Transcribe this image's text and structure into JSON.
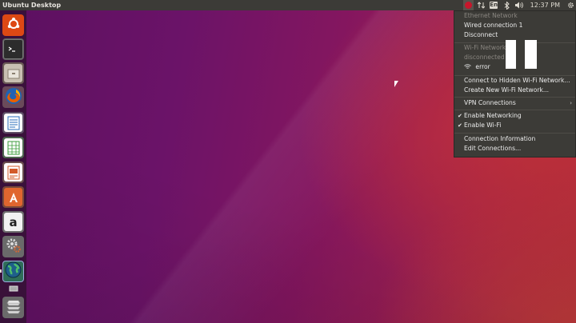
{
  "topbar": {
    "title": "Ubuntu Desktop",
    "clock": "12:37 PM",
    "keyboard_indicator": "En",
    "icons": [
      "network-icon",
      "transfer-arrows-icon",
      "keyboard-layout-icon",
      "bluetooth-icon",
      "volume-icon",
      "gear-icon"
    ]
  },
  "launcher": {
    "items": [
      {
        "name": "ubuntu-dash",
        "icon": "ubuntu-logo-icon",
        "color": "#dd4814"
      },
      {
        "name": "terminal",
        "icon": "terminal-icon",
        "color": "#2c2c2c"
      },
      {
        "name": "file-manager",
        "icon": "file-cabinet-icon",
        "color": "#b4a99a"
      },
      {
        "name": "firefox",
        "icon": "firefox-icon",
        "color": "#e66000"
      },
      {
        "name": "libreoffice-writer",
        "icon": "writer-document-icon",
        "color": "#2a6ebb"
      },
      {
        "name": "libreoffice-calc",
        "icon": "calc-spreadsheet-icon",
        "color": "#3a9b3a"
      },
      {
        "name": "libreoffice-impress",
        "icon": "impress-presentation-icon",
        "color": "#d35b2a"
      },
      {
        "name": "ubuntu-software",
        "icon": "software-bag-icon",
        "color": "#e0662f"
      },
      {
        "name": "amazon",
        "icon": "amazon-icon",
        "color": "#f0f0f0"
      },
      {
        "name": "system-settings",
        "icon": "settings-gears-icon",
        "color": "#6a6a6a"
      },
      {
        "name": "network-globe",
        "icon": "globe-icon",
        "color": "#2e8b57"
      },
      {
        "name": "workspace",
        "icon": "small-window-icon",
        "color": "#888888"
      },
      {
        "name": "trash",
        "icon": "trash-stack-icon",
        "color": "#bbbbbb"
      }
    ]
  },
  "network_menu": {
    "ethernet_header": "Ethernet Network",
    "wired_connection": "Wired connection 1",
    "disconnect": "Disconnect",
    "wifi_header": "Wi-Fi Network",
    "wifi_status": "disconnected",
    "wifi_error": "error",
    "connect_hidden": "Connect to Hidden Wi-Fi Network...",
    "create_new": "Create New Wi-Fi Network...",
    "vpn_connections": "VPN Connections",
    "enable_networking": "Enable Networking",
    "enable_wifi": "Enable Wi-Fi",
    "connection_information": "Connection Information",
    "edit_connections": "Edit Connections...",
    "checkmark": "✔",
    "submenu_arrow": "›"
  }
}
